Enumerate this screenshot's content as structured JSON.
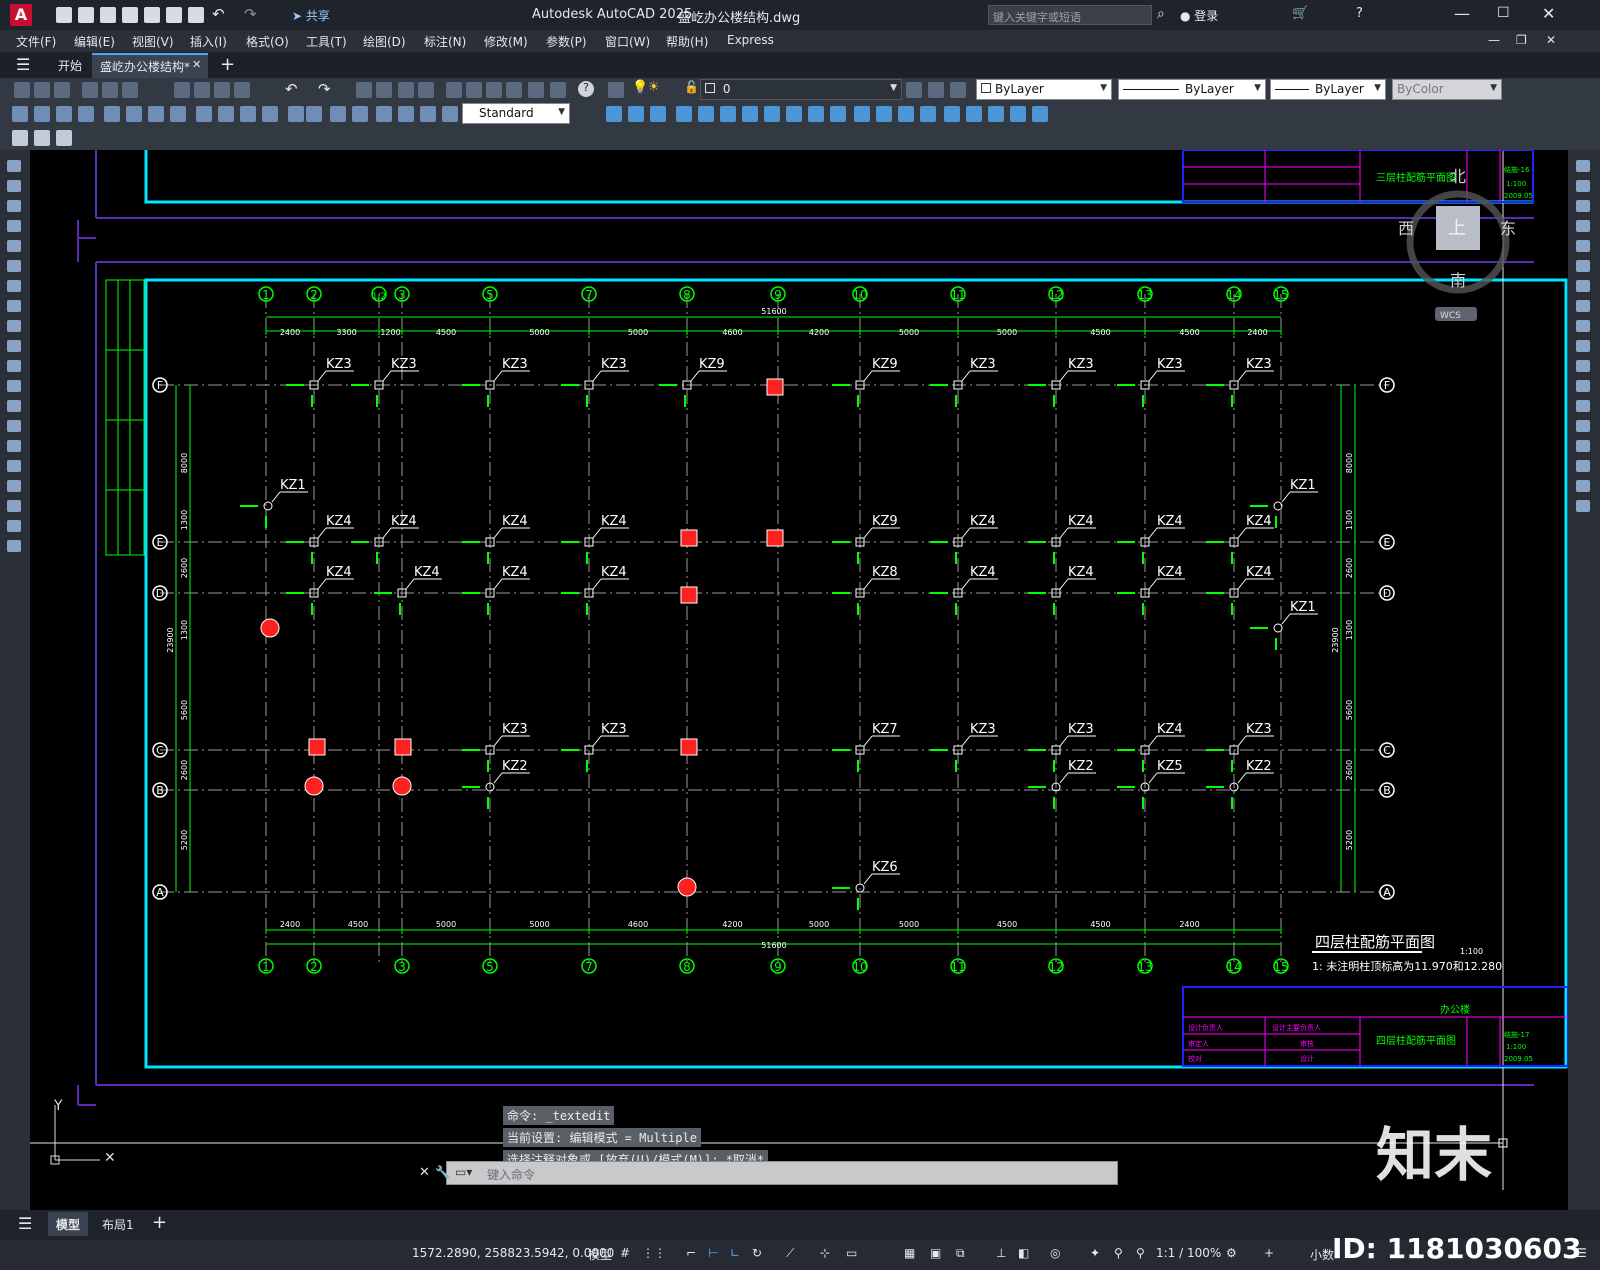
{
  "titlebar": {
    "app_logo": "A",
    "share_label": "共享",
    "title": "Autodesk AutoCAD 2025",
    "document": "盛屹办公楼结构.dwg",
    "search_placeholder": "键入关键字或短语",
    "login_label": "登录"
  },
  "menu": [
    "文件(F)",
    "编辑(E)",
    "视图(V)",
    "插入(I)",
    "格式(O)",
    "工具(T)",
    "绘图(D)",
    "标注(N)",
    "修改(M)",
    "参数(P)",
    "窗口(W)",
    "帮助(H)",
    "Express"
  ],
  "tabs": {
    "start": "开始",
    "active": "盛屹办公楼结构*"
  },
  "layer": {
    "current": "0",
    "color": "ByLayer",
    "linetype": "ByLayer",
    "lineweight": "ByLayer",
    "plotstyle": "ByColor"
  },
  "textstyle": "Standard",
  "viewcube": {
    "north": "北",
    "south": "南",
    "east": "东",
    "west": "西",
    "top": "上",
    "wcs": "WCS"
  },
  "drawing": {
    "title": "四层柱配筋平面图",
    "scale": "1:100",
    "note": "1: 未注明柱顶标高为11.970和12.280",
    "upper_title": "三层柱配筋平面图",
    "lower_title": "四层柱配筋平面图",
    "lower_project": "办公楼",
    "total_dim": "51600",
    "grid_cols": [
      "1",
      "2",
      "1/2",
      "3",
      "5",
      "7",
      "8",
      "9",
      "10",
      "11",
      "12",
      "13",
      "14",
      "15"
    ],
    "bottom_cols": [
      "1",
      "2",
      "3",
      "5",
      "7",
      "8",
      "9",
      "10",
      "11",
      "12",
      "13",
      "14",
      "15"
    ],
    "grid_rows": [
      "F",
      "E",
      "D",
      "C",
      "B",
      "A"
    ],
    "top_dims": [
      "2400",
      "3300",
      "1200",
      "4500",
      "5000",
      "5000",
      "4600",
      "4200",
      "5000",
      "5000",
      "4500",
      "4500",
      "2400"
    ],
    "bottom_dims": [
      "2400",
      "4500",
      "5000",
      "5000",
      "4600",
      "4200",
      "5000",
      "5000",
      "4500",
      "4500",
      "2400"
    ],
    "left_dims": [
      "8000",
      "1300",
      "2600",
      "1300",
      "5600",
      "2600",
      "5200"
    ],
    "overall_left": "23900",
    "title_block": [
      "设计负责人",
      "设计主要负责人",
      "审定人",
      "审核",
      "校对",
      "设计"
    ],
    "tb_code_upper": [
      "结施-16",
      "1:100",
      "2009.05"
    ],
    "tb_code_lower": [
      "结施-17",
      "1:100",
      "2009.05"
    ]
  },
  "columns": {
    "row_F": [
      "KZ3",
      "KZ3",
      "KZ3",
      "KZ3",
      "KZ9",
      "KZ9",
      "KZ3",
      "KZ3",
      "KZ3",
      "KZ3"
    ],
    "row_E": [
      "KZ1",
      "KZ4",
      "KZ4",
      "KZ4",
      "KZ4",
      "KZ9",
      "KZ4",
      "KZ4",
      "KZ4",
      "KZ4",
      "KZ1"
    ],
    "row_D": [
      "KZ4",
      "KZ4",
      "KZ4",
      "KZ4",
      "KZ8",
      "KZ4",
      "KZ4",
      "KZ4",
      "KZ4",
      "KZ1"
    ],
    "row_C": [
      "KZ3",
      "KZ3",
      "KZ7",
      "KZ3",
      "KZ3",
      "KZ4",
      "KZ3"
    ],
    "row_B": [
      "KZ2",
      "KZ2",
      "KZ5",
      "KZ2"
    ],
    "row_A": [
      "KZ6"
    ]
  },
  "command": {
    "lines": [
      "命令: _textedit",
      "当前设置: 编辑模式 = Multiple",
      "选择注释对象或 [放弃(U)/模式(M)]: *取消*"
    ],
    "placeholder": "键入命令"
  },
  "layout_tabs": [
    "模型",
    "布局1"
  ],
  "status": {
    "coords": "1572.2890, 258823.5942, 0.0000",
    "space": "模型",
    "scale": "1:1 / 100%",
    "units": "小数"
  },
  "watermark": {
    "brand": "知末",
    "id": "ID: 1181030603"
  },
  "colors": {
    "cyan": "#00e5ff",
    "green": "#00ff00",
    "magenta": "#ff00ff",
    "red": "#ff2020",
    "purple": "#5b2bb8",
    "blue": "#2020ff",
    "white": "#ffffff"
  }
}
